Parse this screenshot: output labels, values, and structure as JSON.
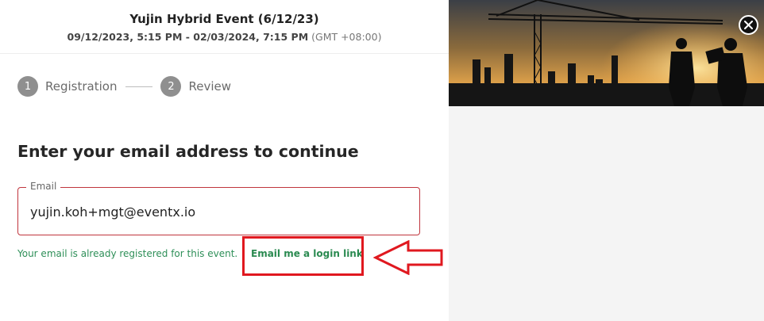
{
  "event": {
    "title": "Yujin Hybrid Event (6/12/23)",
    "date_range": "09/12/2023, 5:15 PM - 02/03/2024, 7:15 PM",
    "timezone": "(GMT +08:00)"
  },
  "steps": [
    {
      "number": "1",
      "label": "Registration"
    },
    {
      "number": "2",
      "label": "Review"
    }
  ],
  "form": {
    "heading": "Enter your email address to continue",
    "email_label": "Email",
    "email_value": "yujin.koh+mgt@eventx.io",
    "status_message": "Your email is already registered for this event.",
    "login_link_label": "Email me a login link"
  },
  "colors": {
    "success_text": "#2e8f58",
    "field_border": "#c0353d",
    "annotation_red": "#e0181f",
    "step_circle": "#8f8f8f"
  },
  "icons": {
    "close": "close-icon",
    "annotation_arrow": "left-arrow-icon"
  }
}
